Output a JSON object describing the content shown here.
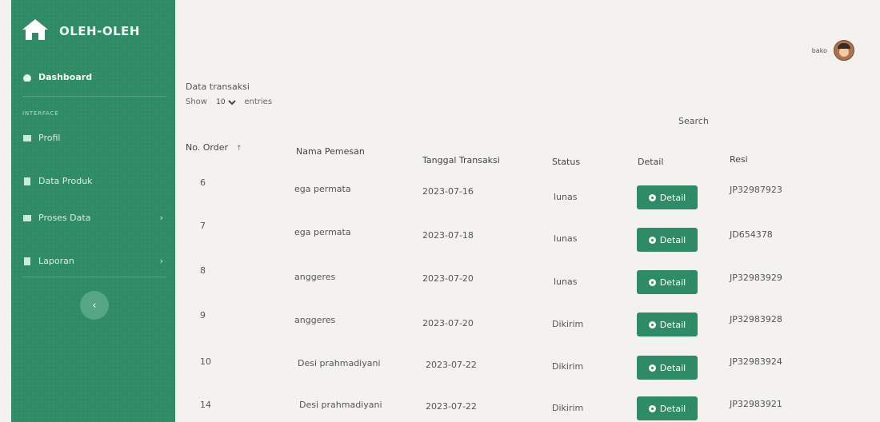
{
  "brand": {
    "name": "OLEH-OLEH"
  },
  "sidebar": {
    "dashboard": "Dashboard",
    "section_label": "INTERFACE",
    "items": [
      {
        "label": "Profil"
      },
      {
        "label": "Data Produk"
      },
      {
        "label": "Proses Data"
      },
      {
        "label": "Laporan"
      }
    ],
    "toggle_glyph": "‹"
  },
  "topbar": {
    "username": "bako"
  },
  "page": {
    "title": "Data transaksi",
    "show_label": "Show",
    "entries_value": "10",
    "entries_label": "entries",
    "search_label": "Search"
  },
  "table": {
    "headers": [
      "No. Order",
      "Nama Pemesan",
      "Tanggal Transaksi",
      "Status",
      "Detail",
      "Resi"
    ],
    "sort_glyph": "↑",
    "detail_label": "Detail",
    "rows": [
      {
        "no": "6",
        "nama": "ega permata",
        "tanggal": "2023-07-16",
        "status": "lunas",
        "resi": "JP32987923"
      },
      {
        "no": "7",
        "nama": "ega permata",
        "tanggal": "2023-07-18",
        "status": "lunas",
        "resi": "JD654378"
      },
      {
        "no": "8",
        "nama": "anggeres",
        "tanggal": "2023-07-20",
        "status": "lunas",
        "resi": "JP32983929"
      },
      {
        "no": "9",
        "nama": "anggeres",
        "tanggal": "2023-07-20",
        "status": "Dikirim",
        "resi": "JP32983928"
      },
      {
        "no": "10",
        "nama": "Desi prahmadiyani",
        "tanggal": "2023-07-22",
        "status": "Dikirim",
        "resi": "JP32983924"
      },
      {
        "no": "14",
        "nama": "Desi prahmadiyani",
        "tanggal": "2023-07-22",
        "status": "Dikirim",
        "resi": "JP32983921"
      }
    ]
  },
  "colors": {
    "primary": "#2f8a66",
    "background": "#f3f2ee"
  }
}
